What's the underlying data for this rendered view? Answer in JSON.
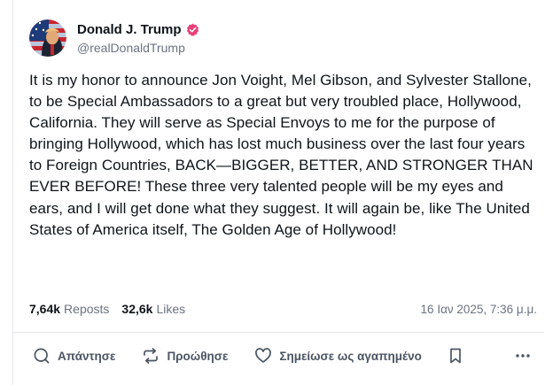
{
  "post": {
    "author": {
      "display_name": "Donald J. Trump",
      "handle": "@realDonaldTrump",
      "verified_icon": "verified-badge-icon",
      "verified_color": "#e8407a"
    },
    "text": "It is my honor to announce Jon Voight, Mel Gibson, and Sylvester Stallone, to be Special Ambassadors to a great but very troubled place, Hollywood, California. They will serve as Special Envoys to me for the purpose of bringing Hollywood, which has lost much business over the last four years to Foreign Countries, BACK—BIGGER, BETTER, AND STRONGER THAN EVER BEFORE! These three very talented people will be my eyes and ears, and I will get done what they suggest. It will again be, like The United States of America itself, The Golden Age of Hollywood!",
    "stats": {
      "reposts_count": "7,64k",
      "reposts_label": "Reposts",
      "likes_count": "32,6k",
      "likes_label": "Likes"
    },
    "timestamp": "16 Ιαν 2025, 7:36 μ.μ."
  },
  "actions": {
    "reply_label": "Απάντησε",
    "retruth_label": "Προώθησε",
    "like_label": "Σημείωσε ως αγαπημένο"
  },
  "colors": {
    "text": "#0f1419",
    "muted": "#6b7280",
    "divider": "#e6e7eb"
  }
}
